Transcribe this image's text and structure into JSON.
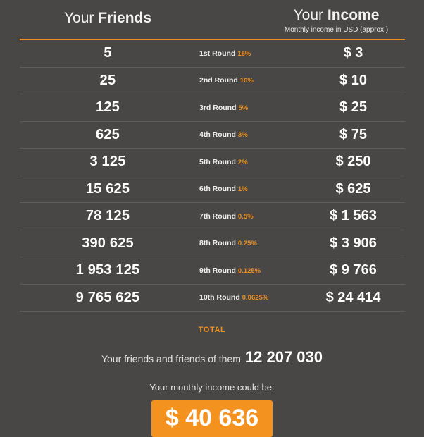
{
  "header": {
    "friends_col": {
      "prefix": "Your ",
      "emphasis": "Friends"
    },
    "income_col": {
      "prefix": "Your ",
      "emphasis": "Income",
      "subtitle": "Monthly income in USD (approx.)"
    }
  },
  "accent_color": "#ef8f1f",
  "background_color": "#484745",
  "table": {
    "rows": [
      {
        "friends": "5",
        "round": "1st Round",
        "percent": "15%",
        "income": "$ 3"
      },
      {
        "friends": "25",
        "round": "2nd Round",
        "percent": "10%",
        "income": "$ 10"
      },
      {
        "friends": "125",
        "round": "3rd Round",
        "percent": "5%",
        "income": "$ 25"
      },
      {
        "friends": "625",
        "round": "4th Round",
        "percent": "3%",
        "income": "$ 75"
      },
      {
        "friends": "3 125",
        "round": "5th Round",
        "percent": "2%",
        "income": "$ 250"
      },
      {
        "friends": "15 625",
        "round": "6th Round",
        "percent": "1%",
        "income": "$ 625"
      },
      {
        "friends": "78 125",
        "round": "7th Round",
        "percent": "0.5%",
        "income": "$ 1 563"
      },
      {
        "friends": "390 625",
        "round": "8th Round",
        "percent": "0.25%",
        "income": "$ 3 906"
      },
      {
        "friends": "1 953 125",
        "round": "9th Round",
        "percent": "0.125%",
        "income": "$ 9 766"
      },
      {
        "friends": "9 765 625",
        "round": "10th Round",
        "percent": "0.0625%",
        "income": "$ 24 414"
      }
    ]
  },
  "footer": {
    "total_label": "TOTAL",
    "total_friends_label": "Your friends and friends of them",
    "total_friends_value": "12 207 030",
    "income_caption": "Your monthly income could be:",
    "income_total": "$ 40 636"
  }
}
